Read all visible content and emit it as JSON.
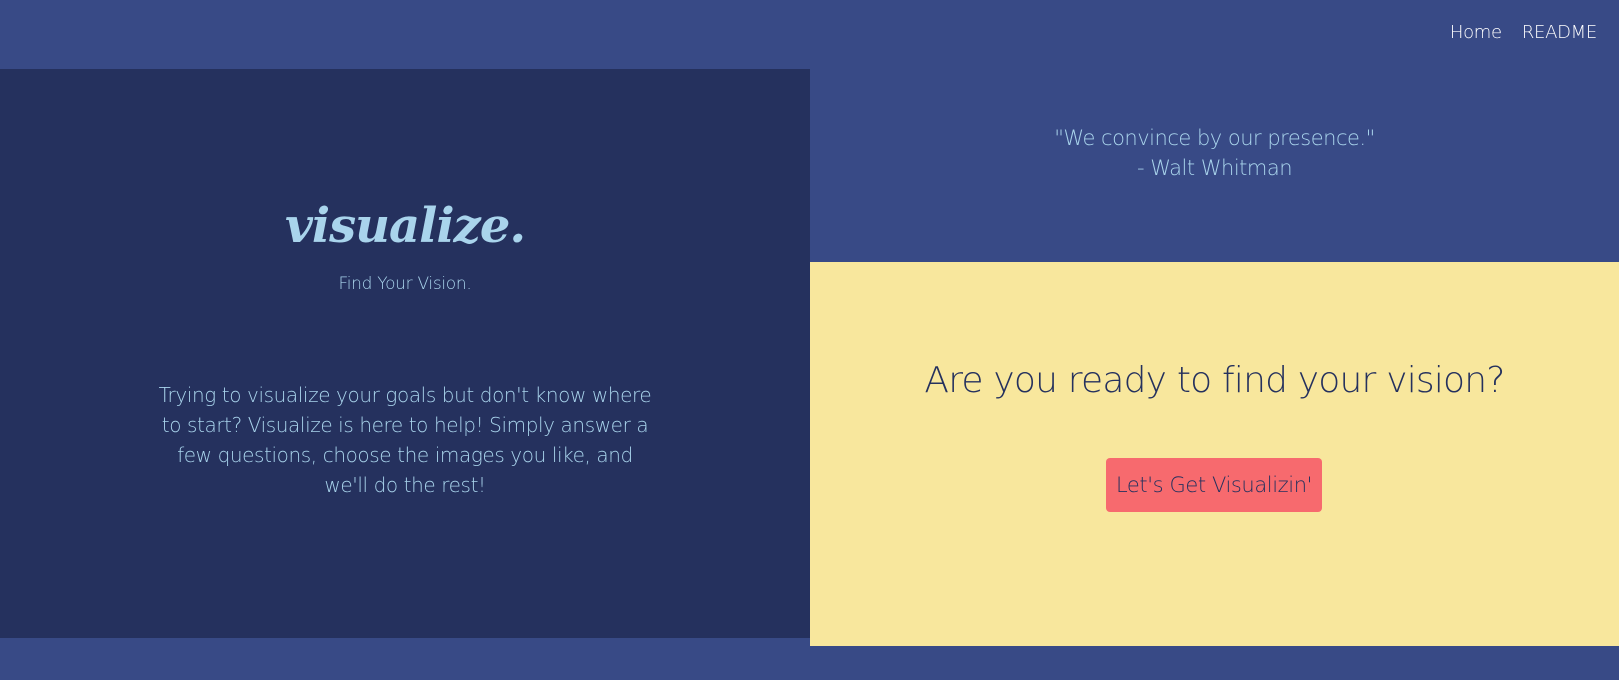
{
  "nav": {
    "links": [
      {
        "label": "Home"
      },
      {
        "label": "README"
      }
    ]
  },
  "hero": {
    "title": "visualize.",
    "tagline": "Find Your Vision.",
    "intro": "Trying to visualize your goals but don't know where to start? Visualize is here to help! Simply answer a few questions, choose the images you like, and we'll do the rest!"
  },
  "quote": {
    "text": "\"We convince by our presence.\"",
    "author": "- Walt Whitman"
  },
  "cta": {
    "heading": "Are you ready to find your vision?",
    "button_label": "Let's Get Visualizin'"
  },
  "colors": {
    "nav_background": "#384a86",
    "left_panel_background": "#25315e",
    "cta_background": "#f8e79d",
    "button_background": "#f76a6e",
    "accent_text": "#a9d4ec"
  }
}
